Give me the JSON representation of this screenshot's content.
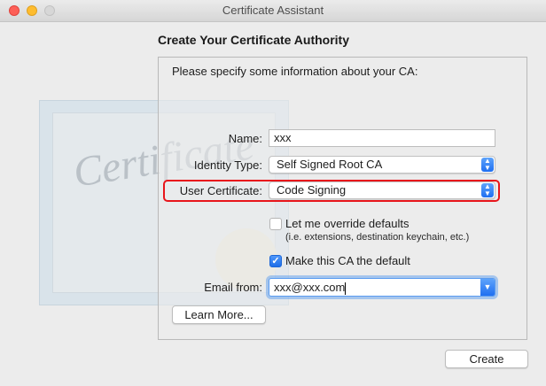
{
  "window": {
    "title": "Certificate Assistant"
  },
  "heading": "Create Your Certificate Authority",
  "intro": "Please specify some information about your CA:",
  "background_art": {
    "word": "Certificate"
  },
  "form": {
    "name_label": "Name:",
    "name_value": "xxx",
    "identity_type_label": "Identity Type:",
    "identity_type_value": "Self Signed Root CA",
    "user_certificate_label": "User Certificate:",
    "user_certificate_value": "Code Signing",
    "override_label": "Let me override defaults",
    "override_sub": "(i.e. extensions, destination keychain, etc.)",
    "override_checked": false,
    "default_ca_label": "Make this CA the default",
    "default_ca_checked": true,
    "email_label": "Email from:",
    "email_value": "xxx@xxx.com"
  },
  "buttons": {
    "learn_more": "Learn More...",
    "create": "Create"
  },
  "colors": {
    "highlight": "#e8151b",
    "accent": "#1f6ff1"
  }
}
